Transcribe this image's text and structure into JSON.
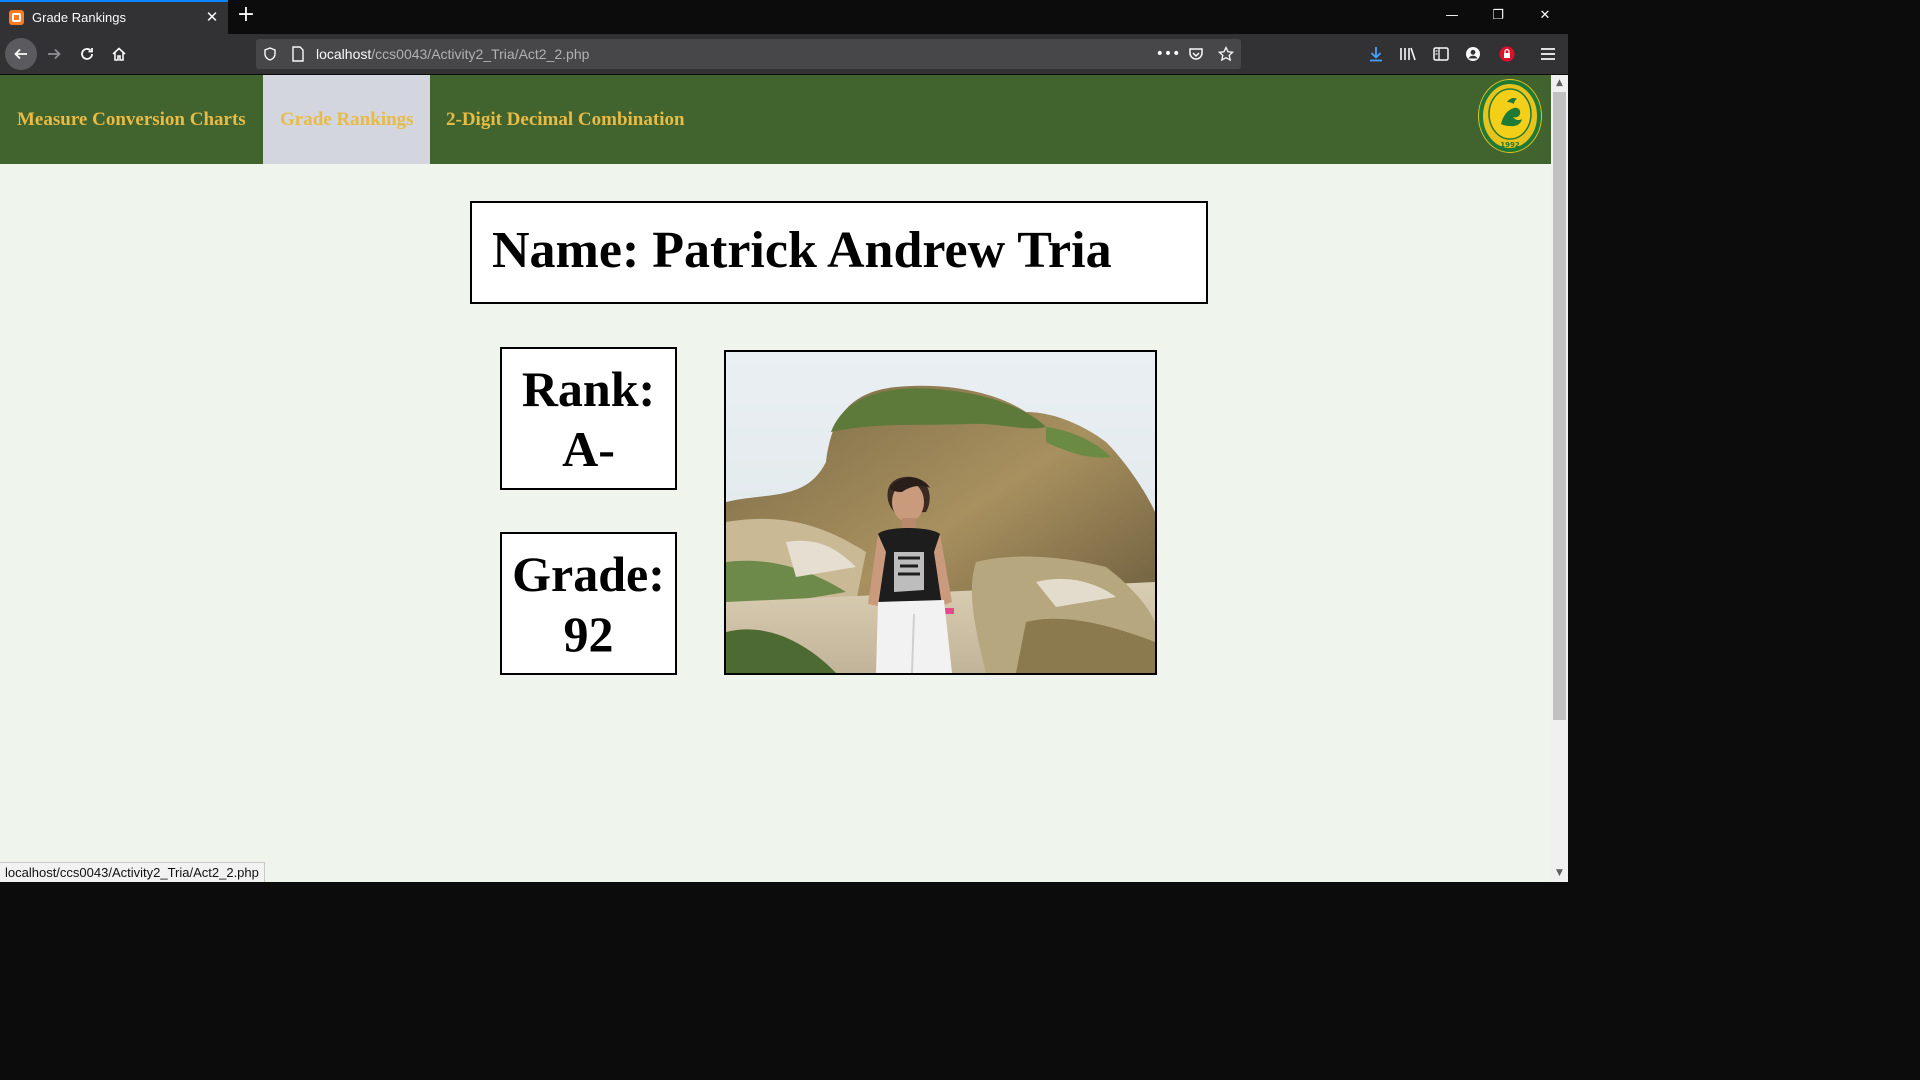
{
  "browser": {
    "tab": {
      "title": "Grade Rankings",
      "close_label": "✕"
    },
    "new_tab_label": "+",
    "url": {
      "host": "localhost",
      "path": "/ccs0043/Activity2_Tria/Act2_2.php"
    },
    "window_controls": {
      "minimize": "—",
      "restore": "❐",
      "close": "✕"
    },
    "status_url": "localhost/ccs0043/Activity2_Tria/Act2_2.php"
  },
  "site": {
    "nav": [
      {
        "label": "Measure Conversion Charts"
      },
      {
        "label": "Grade Rankings"
      },
      {
        "label": "2-Digit Decimal Combination"
      }
    ],
    "logo": {
      "year": "1992"
    }
  },
  "profile": {
    "name_label": "Name: Patrick Andrew Tria",
    "rank_label": "Rank:",
    "rank_value": "A-",
    "grade_label": "Grade:",
    "grade_value": "92"
  },
  "theme": {
    "nav_bg": "#41632d",
    "nav_text": "#e7bb45",
    "nav_active_bg": "#d3d6df",
    "page_bg": "#eff5ec"
  }
}
